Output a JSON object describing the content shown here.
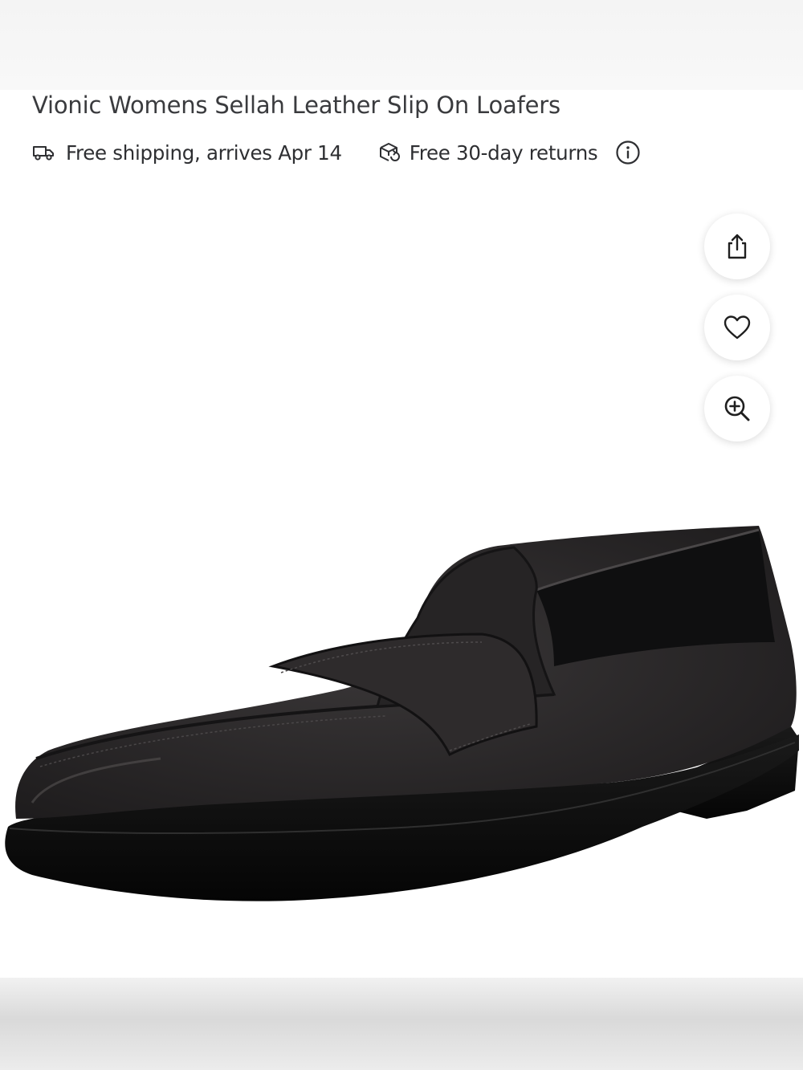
{
  "product": {
    "title": "Vionic Womens Sellah Leather Slip On Loafers",
    "image_alt": "Black pebbled leather slip-on penny loafer"
  },
  "badges": {
    "shipping": {
      "text": "Free shipping, arrives Apr 14",
      "icon": "truck-icon"
    },
    "returns": {
      "text": "Free 30-day returns",
      "icon": "return-box-icon"
    },
    "info_icon": "info-icon"
  },
  "actions": [
    {
      "name": "share",
      "icon": "share-icon"
    },
    {
      "name": "favorite",
      "icon": "heart-icon"
    },
    {
      "name": "zoom",
      "icon": "zoom-in-icon"
    }
  ],
  "colors": {
    "text": "#2e2f32",
    "shoe_leather": "#2a2829",
    "shoe_sole": "#111111"
  }
}
